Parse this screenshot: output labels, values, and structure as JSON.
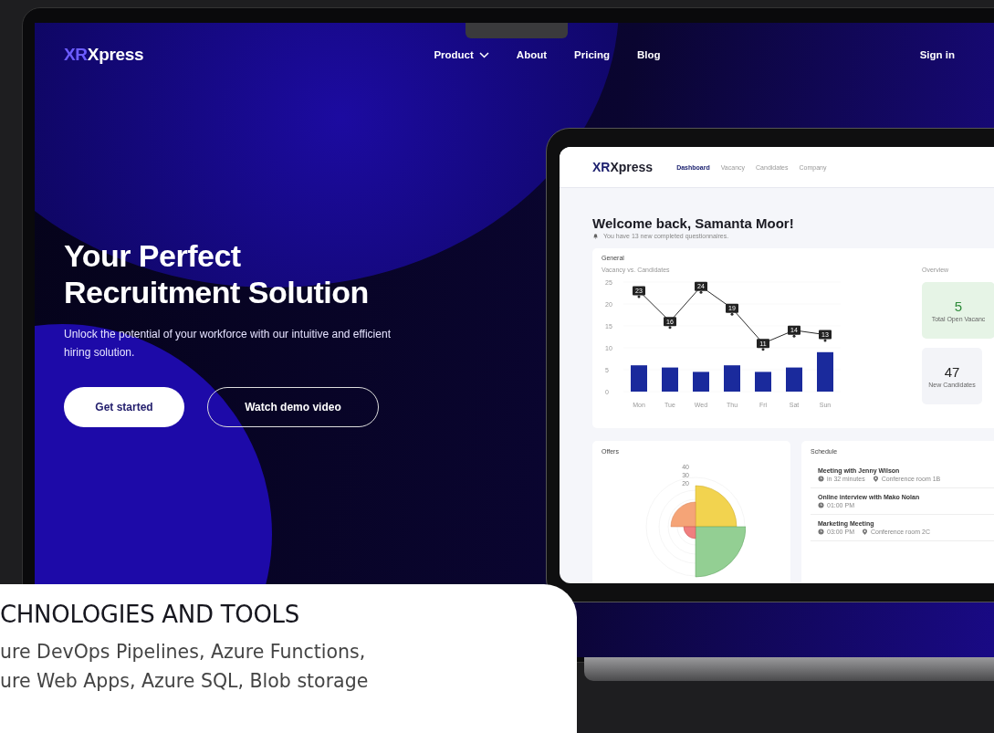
{
  "site": {
    "logo": {
      "accent": "XR",
      "text": "Xpress"
    },
    "nav": [
      {
        "label": "Product",
        "dropdown": true
      },
      {
        "label": "About",
        "dropdown": false
      },
      {
        "label": "Pricing",
        "dropdown": false
      },
      {
        "label": "Blog",
        "dropdown": false
      }
    ],
    "sign_in": "Sign in"
  },
  "hero": {
    "title_lines": [
      "Your Perfect",
      "Recruitment Solution"
    ],
    "subtitle": "Unlock the potential of your workforce with our intuitive and efficient hiring solution.",
    "buttons": [
      {
        "label": "Get started",
        "kind": "primary"
      },
      {
        "label": "Watch demo video",
        "kind": "outline"
      }
    ]
  },
  "dashboard": {
    "logo": {
      "accent": "XR",
      "text": "Xpress"
    },
    "tabs": [
      {
        "label": "Dashboard",
        "selected": true
      },
      {
        "label": "Vacancy",
        "selected": false
      },
      {
        "label": "Candidates",
        "selected": false
      },
      {
        "label": "Company",
        "selected": false
      }
    ],
    "welcome": "Welcome back, Samanta Moor!",
    "notice": "You have 13 new completed questionnaires.",
    "general": {
      "title": "General",
      "chart_data": {
        "type": "bar",
        "title": "Vacancy vs. Candidates",
        "categories": [
          "Mon",
          "Tue",
          "Wed",
          "Thu",
          "Fri",
          "Sat",
          "Sun"
        ],
        "ylim": [
          0,
          25
        ],
        "yticks": [
          0,
          5,
          10,
          15,
          20,
          25
        ],
        "series": [
          {
            "color": "#1a2a9c",
            "values": [
              6,
              5.5,
              4.5,
              6,
              4.5,
              5.5,
              9
            ]
          },
          {
            "type": "line",
            "color": "#2b2b2b",
            "values": [
              23,
              16,
              24,
              19,
              11,
              14,
              13
            ],
            "data_labels": true,
            "marker": true
          }
        ]
      },
      "overview": {
        "title": "Overview",
        "stats": [
          {
            "value": "5",
            "label": "Total Open Vacanc",
            "kind": "highlight"
          },
          {
            "value": "47",
            "label": "New Candidates",
            "kind": "plain"
          }
        ]
      }
    },
    "offers": {
      "title": "Offers",
      "scale_labels": [
        "40",
        "30",
        "20"
      ]
    },
    "schedule": {
      "title": "Schedule",
      "items": [
        {
          "title": "Meeting with Jenny Wilson",
          "time": "in 32 minutes",
          "place": "Conference room 1B"
        },
        {
          "title": "Online interview with Mako Nolan",
          "time": "01:00 PM"
        },
        {
          "title": "Marketing Meeting",
          "time": "03:00 PM",
          "place": "Conference room 2C"
        }
      ]
    }
  },
  "card": {
    "heading": "CHNOLOGIES AND TOOLS",
    "lines": [
      "ure DevOps Pipelines, Azure Functions,",
      "ure Web Apps, Azure SQL, Blob storage"
    ]
  }
}
